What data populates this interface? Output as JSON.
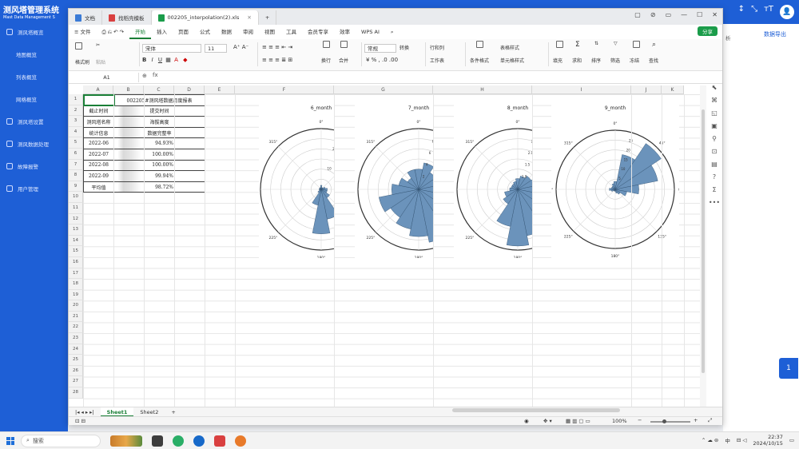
{
  "bg_app": {
    "title": "测风塔管理系统",
    "subtitle": "Mast Data Management S",
    "nav": [
      {
        "label": "测风塔概览",
        "sub": false
      },
      {
        "label": "地图概览",
        "sub": true
      },
      {
        "label": "列表概览",
        "sub": true
      },
      {
        "label": "网格概览",
        "sub": true
      },
      {
        "label": "测风塔设置",
        "sub": false
      },
      {
        "label": "测风数据处理",
        "sub": false
      },
      {
        "label": "故障报警",
        "sub": false
      },
      {
        "label": "用户管理",
        "sub": false
      }
    ],
    "top_icons": [
      "↕",
      "⤡",
      "тT"
    ],
    "avatar_glyph": "👤",
    "tab_other": "析",
    "tab_export": "数据导出",
    "page_btn": "1"
  },
  "wps": {
    "tabs": [
      {
        "label": "文档",
        "color": "#3b7bd6",
        "active": false
      },
      {
        "label": "找稻壳模板",
        "color": "#d94040",
        "active": false
      },
      {
        "label": "002205_interpolation(2).xls",
        "color": "#1a9c4a",
        "active": true
      }
    ],
    "new_tab": "+",
    "window_controls": [
      "▢",
      "⊘",
      "▭",
      "—",
      "☐",
      "✕"
    ],
    "menu": [
      "≡ 文件",
      "开始",
      "插入",
      "页面",
      "公式",
      "数据",
      "审阅",
      "视图",
      "工具",
      "会员专享",
      "效率",
      "WPS AI"
    ],
    "active_menu": "开始",
    "share_label": "分享",
    "ribbon": {
      "format_painter": "格式刷",
      "paste": "粘贴",
      "font_name": "宋体",
      "font_size": "11",
      "wrap": "换行",
      "merge": "合并",
      "number_format": "常规",
      "convert": "转换",
      "row_col": "行和列",
      "worksheet": "工作表",
      "cond_format": "条件格式",
      "table_style": "表格样式",
      "cell_style": "单元格样式",
      "fill": "填充",
      "sum": "求和",
      "sort": "排序",
      "filter": "筛选",
      "freeze": "冻结",
      "find": "查找"
    },
    "name_box": "A1",
    "fx": "fx",
    "columns": [
      "A",
      "B",
      "C",
      "D",
      "E",
      "F",
      "G",
      "H",
      "I",
      "J",
      "K"
    ],
    "rows": [
      "1",
      "2",
      "3",
      "4",
      "5",
      "6",
      "7",
      "8",
      "9",
      "10",
      "11",
      "12",
      "13",
      "14",
      "15",
      "16",
      "17",
      "18",
      "19",
      "20",
      "21",
      "22",
      "23",
      "24",
      "25",
      "26",
      "27",
      "28"
    ],
    "table": [
      [
        "",
        "002205#测风塔数据月度报表",
        "",
        ""
      ],
      [
        "截止时间",
        "",
        "提交时间",
        ""
      ],
      [
        "测风塔名称",
        "",
        "海拔高度",
        ""
      ],
      [
        "统计信息",
        "",
        "数据完整率",
        ""
      ],
      [
        "2022-06",
        "",
        "94.93%",
        ""
      ],
      [
        "2022-07",
        "",
        "100.00%",
        ""
      ],
      [
        "2022-08",
        "",
        "100.00%",
        ""
      ],
      [
        "2022-09",
        "",
        "99.94%",
        ""
      ],
      [
        "平均值",
        "",
        "98.72%",
        ""
      ]
    ],
    "sheets": [
      "Sheet1",
      "Sheet2"
    ],
    "active_sheet": "Sheet1",
    "zoom": "100%"
  },
  "chart_data": [
    {
      "type": "polar-bar",
      "title": "6_month",
      "dir_labels": [
        "0°",
        "45°",
        "90°",
        "135°",
        "180°",
        "225°",
        "270°",
        "315°"
      ],
      "rlabels": [
        "10",
        "20"
      ],
      "values": [
        2,
        1,
        1,
        2,
        3,
        3,
        5,
        15,
        22,
        8,
        2,
        1,
        1,
        1,
        1,
        1
      ],
      "rmax": 30
    },
    {
      "type": "polar-bar",
      "title": "7_month",
      "dir_labels": [
        "0°",
        "45°",
        "90°",
        "135°",
        "180°",
        "225°",
        "270°",
        "315°"
      ],
      "rlabels": [
        "2",
        "4",
        "6",
        "8"
      ],
      "values": [
        3,
        4,
        3,
        5,
        6,
        6,
        7,
        8,
        7,
        6,
        5,
        6,
        4,
        3,
        2,
        3
      ],
      "rmax": 9
    },
    {
      "type": "polar-bar",
      "title": "8_month",
      "dir_labels": [
        "0°",
        "45°",
        "90°",
        "135°",
        "180°",
        "225°",
        "270°",
        "315°"
      ],
      "rlabels": [
        "1.0",
        "1.5",
        "2.0",
        "2.5"
      ],
      "values": [
        0.8,
        1.0,
        1.2,
        1.5,
        1.2,
        1.8,
        2.5,
        3.5,
        4.2,
        2.8,
        1.3,
        1.0,
        0.6,
        0.5,
        0.5,
        0.6
      ],
      "rmax": 4.5
    },
    {
      "type": "polar-bar",
      "title": "9_month",
      "dir_labels": [
        "0°",
        "45°",
        "90°",
        "135°",
        "180°",
        "225°",
        "270°",
        "315°"
      ],
      "rlabels": [
        "5",
        "10",
        "15",
        "20",
        "25"
      ],
      "values": [
        4,
        18,
        28,
        22,
        12,
        6,
        3,
        2,
        1,
        1,
        1,
        2,
        3,
        2,
        2,
        3
      ],
      "rmax": 30
    }
  ],
  "taskbar": {
    "search": "搜索",
    "lang": "中",
    "time": "22:37",
    "date": "2024/10/15"
  }
}
